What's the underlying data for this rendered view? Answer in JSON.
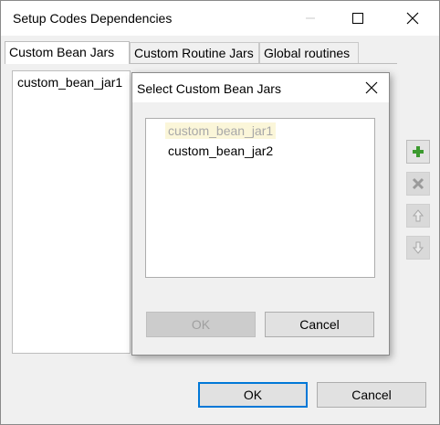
{
  "window": {
    "title": "Setup Codes Dependencies"
  },
  "tabs": [
    {
      "label": "Custom Bean Jars"
    },
    {
      "label": "Custom Routine Jars"
    },
    {
      "label": "Global routines"
    }
  ],
  "left_list": {
    "items": [
      "custom_bean_jar1"
    ]
  },
  "side_buttons": {
    "add_color": "#3c9a2f"
  },
  "dialog": {
    "title": "Select Custom Bean Jars",
    "items": [
      "custom_bean_jar1",
      "custom_bean_jar2"
    ],
    "ok_label": "OK",
    "cancel_label": "Cancel"
  },
  "footer": {
    "ok_label": "OK",
    "cancel_label": "Cancel"
  }
}
